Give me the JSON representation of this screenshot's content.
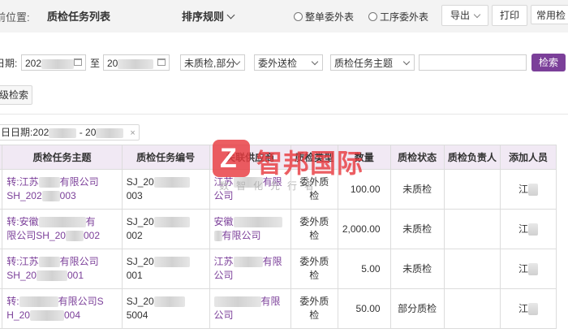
{
  "header": {
    "position_label": "前位置:",
    "page_title": "质检任务列表",
    "sort_label": "排序规则",
    "radio_outsource": "整单委外表",
    "radio_process": "工序委外表",
    "export_label": "导出",
    "print_label": "打印",
    "common_label": "常用检"
  },
  "filters": {
    "date_label": "日期:",
    "date_from": "202",
    "to_label": "至",
    "date_to": "20",
    "status_value": "未质检,部分",
    "type_value": "委外送检",
    "field_value": "质检任务主题",
    "keyword_value": "",
    "search_label": "检索",
    "advanced_label": "级检索"
  },
  "active_tag": {
    "label": "日日期:202",
    "sep": " - 20",
    "close": "×"
  },
  "table": {
    "headers": [
      "",
      "质检任务主题",
      "质检任务编号",
      "关联供应商",
      "质检类型",
      "数量",
      "质检状态",
      "质检负责人",
      "添加人员"
    ],
    "rows": [
      {
        "theme_a": "转:江苏",
        "theme_b": "有限公司",
        "theme_c": "SH_202",
        "theme_d": "003",
        "code_a": "SJ_20",
        "code_b": "003",
        "supplier_a": "江苏",
        "supplier_b": "有限",
        "supplier_c": "公司",
        "type": "委外质检",
        "qty": "100.00",
        "status": "未质检",
        "owner": "",
        "adder": "江"
      },
      {
        "theme_a": "转:安徽",
        "theme_b": "有",
        "theme_c": "限公司SH_20",
        "theme_d": "002",
        "code_a": "SJ_20",
        "code_b": "002",
        "supplier_a": "安徽",
        "supplier_b": "",
        "supplier_c": "有限公司",
        "type": "委外质检",
        "qty": "2,000.00",
        "status": "未质检",
        "owner": "",
        "adder": "江"
      },
      {
        "theme_a": "转:江苏",
        "theme_b": "有限公司",
        "theme_c": "SH_20",
        "theme_d": "001",
        "code_a": "SJ_20",
        "code_b": "001",
        "supplier_a": "江苏",
        "supplier_b": "有限",
        "supplier_c": "公司",
        "type": "委外质检",
        "qty": "5.00",
        "status": "未质检",
        "owner": "",
        "adder": "江"
      },
      {
        "theme_a": "转:",
        "theme_b": "有限公司S",
        "theme_c": "H_20",
        "theme_d": "004",
        "code_a": "SJ_20",
        "code_b": "5004",
        "supplier_a": "",
        "supplier_b": "有限",
        "supplier_c": "公司",
        "type": "委外质检",
        "qty": "50.00",
        "status": "部分质检",
        "owner": "",
        "adder": "江"
      }
    ]
  },
  "watermark": {
    "logo_letter": "Z",
    "brand": "智邦国际",
    "sub": "数智化先行者"
  },
  "colors": {
    "accent": "#7b3f99",
    "header_bg": "#f1e9f4",
    "watermark": "#e83a40"
  }
}
